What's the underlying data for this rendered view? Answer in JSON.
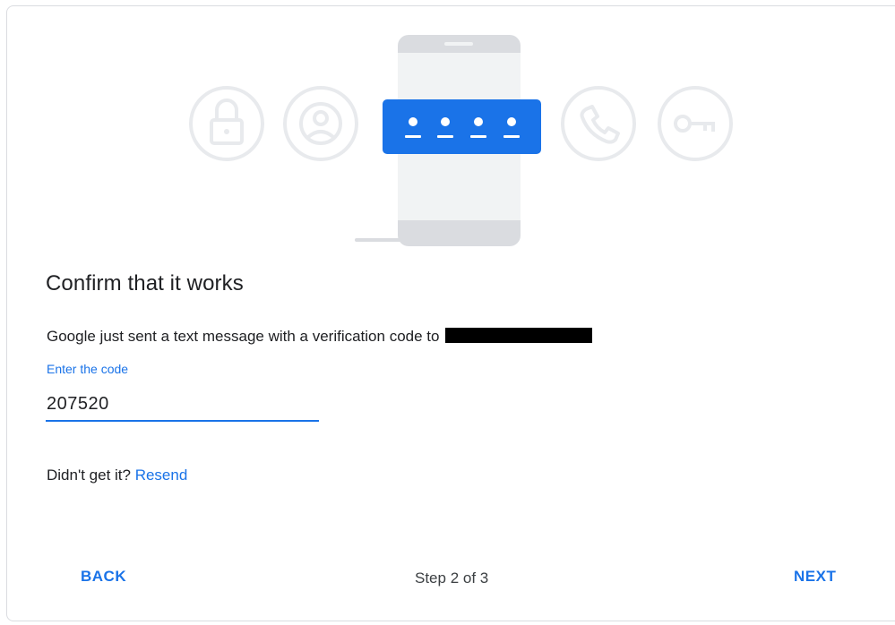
{
  "illustration": {
    "icons": [
      "lock-icon",
      "account-icon",
      "verification-code-icon",
      "phone-icon",
      "key-icon"
    ],
    "accent_color": "#1a73e8",
    "code_dots": 4
  },
  "title": "Confirm that it works",
  "description": "Google just sent a text message with a verification code to",
  "code_field": {
    "label": "Enter the code",
    "value": "207520"
  },
  "resend": {
    "prompt": "Didn't get it?",
    "link": "Resend"
  },
  "footer": {
    "back_label": "BACK",
    "step_text": "Step 2 of 3",
    "next_label": "NEXT"
  }
}
